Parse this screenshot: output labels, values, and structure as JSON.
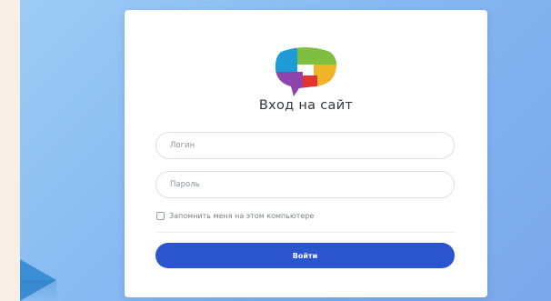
{
  "page": {
    "title": "Вход на сайт"
  },
  "form": {
    "login_placeholder": "Логин",
    "password_placeholder": "Пароль",
    "remember_label": "Запомнить меня на этом компьютере",
    "remember_checked": false,
    "submit_label": "Войти"
  },
  "colors": {
    "background_gradient": [
      "#9cccf4",
      "#7aa7ea"
    ],
    "accent": "#2b55cf",
    "logo": [
      "#1f9bd7",
      "#7fbf3f",
      "#f0b429",
      "#e3342f",
      "#8e44ad"
    ]
  },
  "icons": {
    "logo": "speech-bubble-logo",
    "corner": "arrow-right-shape"
  }
}
